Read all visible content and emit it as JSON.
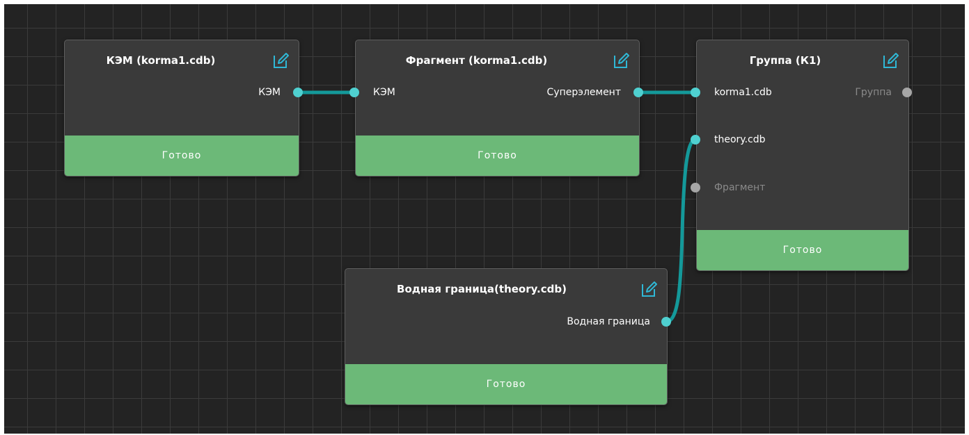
{
  "colors": {
    "canvas": "#232323",
    "grid": "#3b3b3b",
    "node": "#3a3a3a",
    "ready": "#6cb978",
    "port_active": "#4fd0d0",
    "port_inactive": "#a6a6a6",
    "wire": "#14999a",
    "edit_icon": "#2fb8d6"
  },
  "nodes": {
    "kem": {
      "title": "КЭМ (korma1.cdb)",
      "output": "КЭМ",
      "status": "Готово",
      "icon": "edit-icon"
    },
    "fragment": {
      "title": "Фрагмент (korma1.cdb)",
      "input": "КЭМ",
      "output": "Суперэлемент",
      "status": "Готово",
      "icon": "edit-icon"
    },
    "group": {
      "title": "Группа (К1)",
      "inputs": [
        "korma1.cdb",
        "theory.cdb",
        "Фрагмент"
      ],
      "output": "Группа",
      "status": "Готово",
      "icon": "edit-icon"
    },
    "water": {
      "title": "Водная граница(theory.cdb)",
      "output": "Водная граница",
      "status": "Готово",
      "icon": "edit-icon"
    }
  }
}
